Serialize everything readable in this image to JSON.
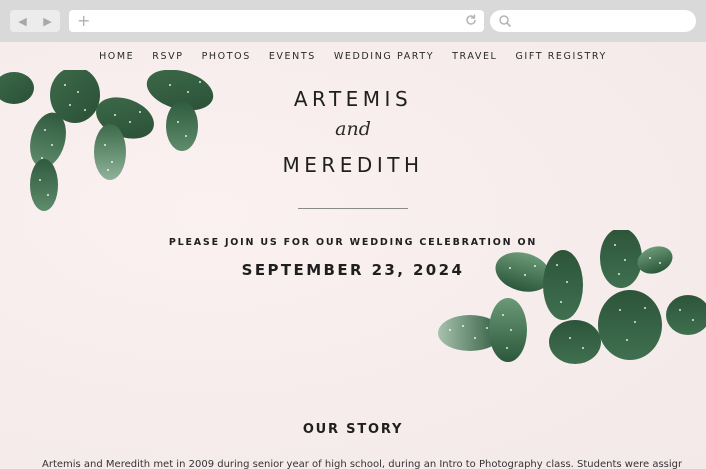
{
  "browser": {
    "back_icon": "back-arrow-icon",
    "forward_icon": "forward-arrow-icon",
    "new_tab_icon": "plus-icon",
    "reload_icon": "reload-icon",
    "search_icon": "search-icon",
    "url_value": "",
    "search_value": ""
  },
  "nav": {
    "items": [
      {
        "label": "HOME"
      },
      {
        "label": "RSVP"
      },
      {
        "label": "PHOTOS"
      },
      {
        "label": "EVENTS"
      },
      {
        "label": "WEDDING PARTY"
      },
      {
        "label": "TRAVEL"
      },
      {
        "label": "GIFT REGISTRY"
      }
    ]
  },
  "hero": {
    "name1": "ARTEMIS",
    "and": "and",
    "name2": "MEREDITH",
    "invite": "PLEASE JOIN US FOR OUR WEDDING CELEBRATION ON",
    "date": "SEPTEMBER 23, 2024"
  },
  "story": {
    "title": "OUR STORY",
    "text": "Artemis and Meredith met in 2009 during senior year of high school, during an Intro to Photography class. Students were assigned a"
  },
  "colors": {
    "page_background": "#f7eded",
    "cactus_dark": "#2f5a3e",
    "cactus_light": "#6f9a7c",
    "text": "#1f1f1f"
  }
}
